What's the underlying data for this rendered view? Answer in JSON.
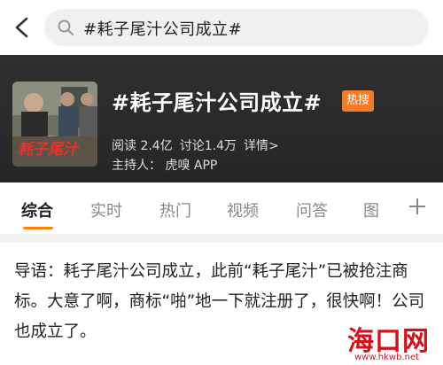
{
  "search": {
    "query": "#耗子尾汁公司成立#"
  },
  "topic": {
    "title": "#耗子尾汁公司成立#",
    "badge": "热搜",
    "reads": "阅读 2.4亿",
    "discussions": "讨论1.4万",
    "details": "详情>",
    "host": "主持人： 虎嗅 APP",
    "thumb_caption": "耗子尾汁"
  },
  "tabs": [
    "综合",
    "实时",
    "热门",
    "视频",
    "问答",
    "图"
  ],
  "content": {
    "text": "导语：耗子尾汁公司成立，此前“耗子尾汁”已被抢注商标。大意了啊，商标“啪”地一下就注册了，很快啊！公司也成立了。"
  },
  "watermark": {
    "name": "海口网",
    "url": "www.hkwb.net"
  },
  "colors": {
    "accent": "#ff8200",
    "hot_badge": "#f47b27",
    "header_bg": "#2b2b2b",
    "watermark": "#d1121b"
  }
}
